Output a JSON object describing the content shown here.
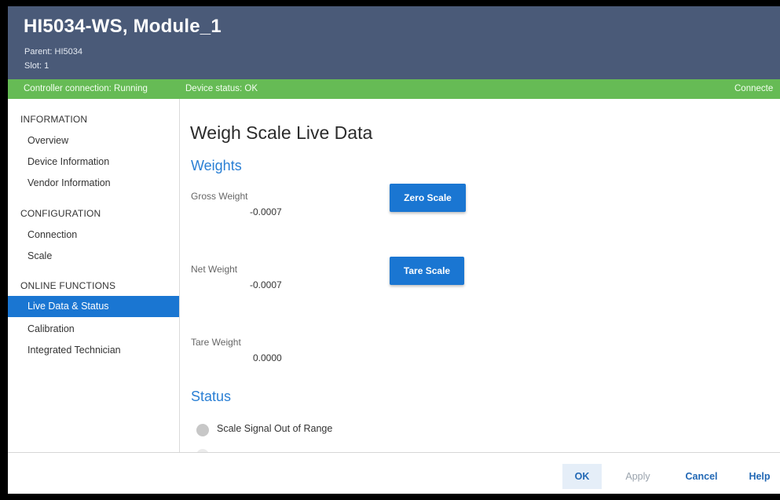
{
  "header": {
    "title": "HI5034-WS, Module_1",
    "parent": "Parent: HI5034",
    "slot": "Slot: 1"
  },
  "statusbar": {
    "controller": "Controller connection: Running",
    "device": "Device status: OK",
    "connection": "Connecte"
  },
  "sidebar": {
    "sections": [
      {
        "title": "INFORMATION",
        "items": [
          "Overview",
          "Device Information",
          "Vendor Information"
        ]
      },
      {
        "title": "CONFIGURATION",
        "items": [
          "Connection",
          "Scale"
        ]
      },
      {
        "title": "ONLINE FUNCTIONS",
        "items": [
          "Live Data & Status",
          "Calibration",
          "Integrated Technician"
        ]
      }
    ],
    "active_item": "Live Data & Status"
  },
  "main": {
    "page_title": "Weigh Scale Live Data",
    "weights_title": "Weights",
    "gross_label": "Gross Weight",
    "gross_value": "-0.0007",
    "net_label": "Net Weight",
    "net_value": "-0.0007",
    "tare_label": "Tare Weight",
    "tare_value": "0.0000",
    "zero_button": "Zero Scale",
    "tare_button": "Tare Scale",
    "status_title": "Status",
    "status_items": [
      "Scale Signal Out of Range"
    ]
  },
  "footer": {
    "ok": "OK",
    "apply": "Apply",
    "cancel": "Cancel",
    "help": "Help"
  },
  "colors": {
    "header_bg": "#4a5a78",
    "status_bar_green": "#66bb55",
    "accent_blue": "#1a76d2",
    "section_blue": "#2a7fd4",
    "status_dot_grey": "#c7c7c7"
  }
}
